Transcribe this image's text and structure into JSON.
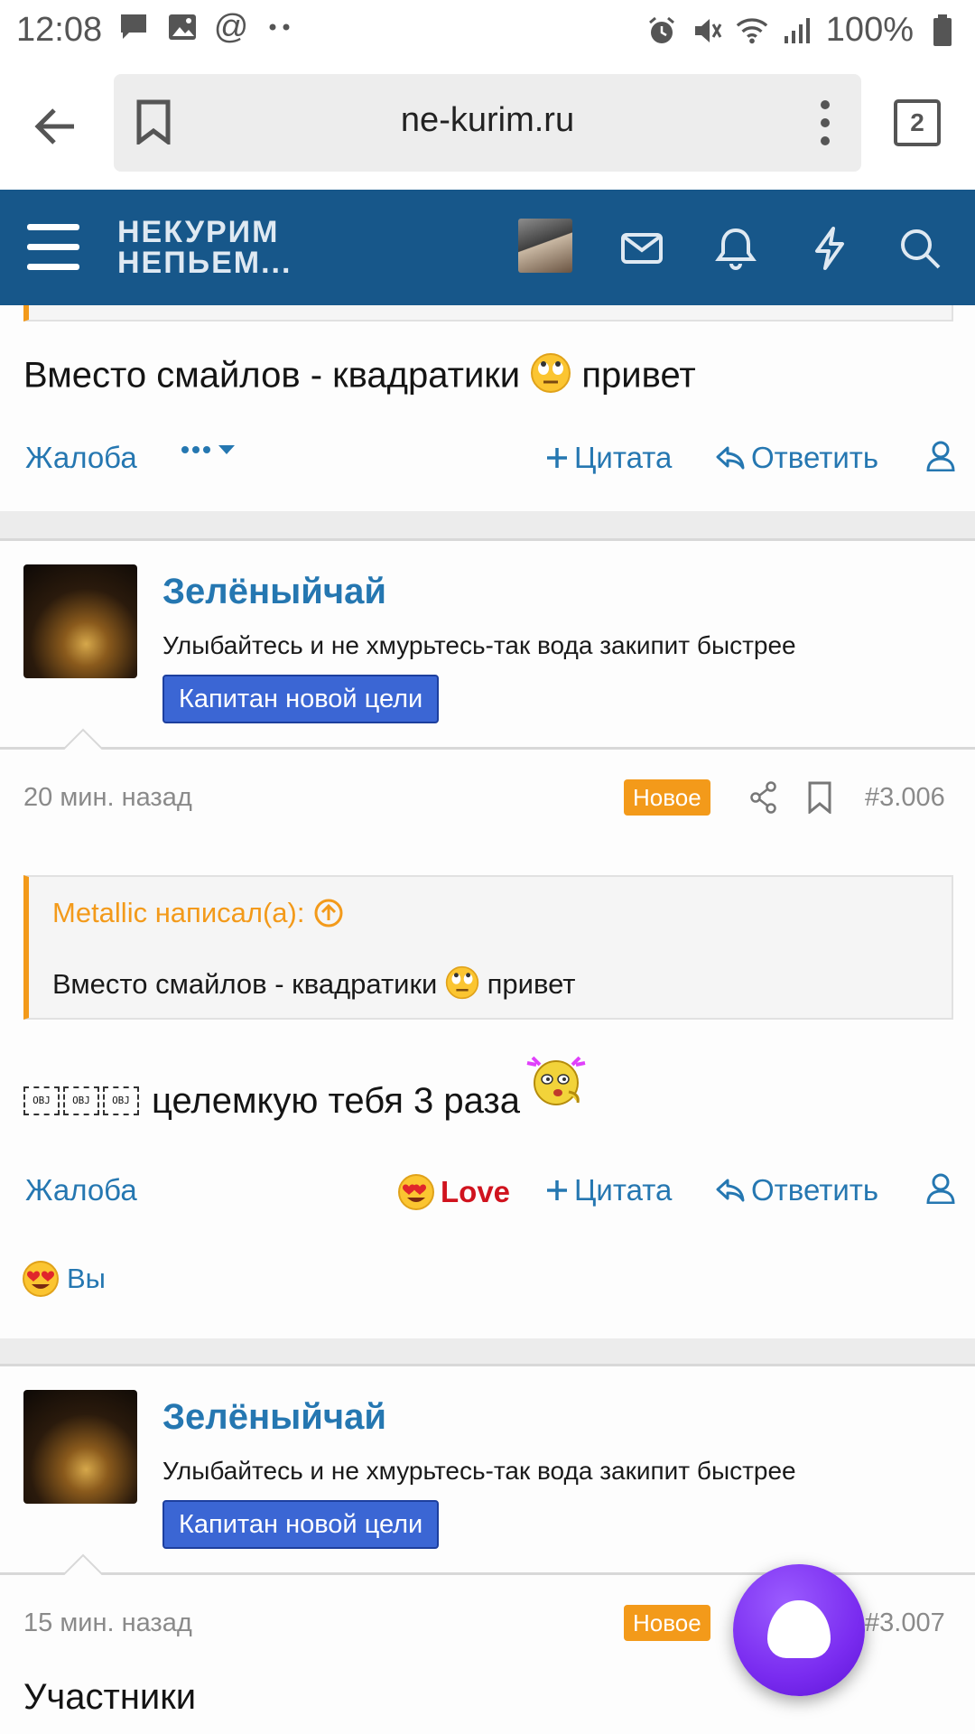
{
  "status_bar": {
    "time": "12:08",
    "battery": "100%"
  },
  "browser": {
    "url": "ne-kurim.ru",
    "tab_count": "2"
  },
  "site": {
    "logo_line1": "НЕКУРИМ",
    "logo_line2": "НЕПЬЕМ..."
  },
  "prev_post": {
    "text_before": "Вместо смайлов - квадратики",
    "text_after": "привет",
    "actions": {
      "report": "Жалоба",
      "quote": "Цитата",
      "reply": "Ответить"
    }
  },
  "post1": {
    "username": "Зелёныйчай",
    "user_title": "Улыбайтесь и не хмурьтесь-так вода закипит быстрее",
    "badge": "Капитан новой цели",
    "time": "20 мин. назад",
    "new_label": "Новое",
    "number": "#3.006",
    "quote_author": "Metallic написал(а):",
    "quote_before": "Вместо смайлов - квадратики",
    "quote_after": "привет",
    "obj_label": "OBJ",
    "message": "целемкую тебя 3 раза",
    "actions": {
      "report": "Жалоба",
      "love": "Love",
      "quote": "Цитата",
      "reply": "Ответить"
    },
    "reaction_by": "Вы"
  },
  "post2": {
    "username": "Зелёныйчай",
    "user_title": "Улыбайтесь и не хмурьтесь-так вода закипит быстрее",
    "badge": "Капитан новой цели",
    "time": "15 мин. назад",
    "new_label": "Новое",
    "number": "#3.007",
    "text": "Участники"
  },
  "colors": {
    "header": "#17578a",
    "link": "#2577b1",
    "accent_orange": "#f39a1a",
    "badge_blue": "#3b66d4",
    "love_red": "#d0131e"
  }
}
